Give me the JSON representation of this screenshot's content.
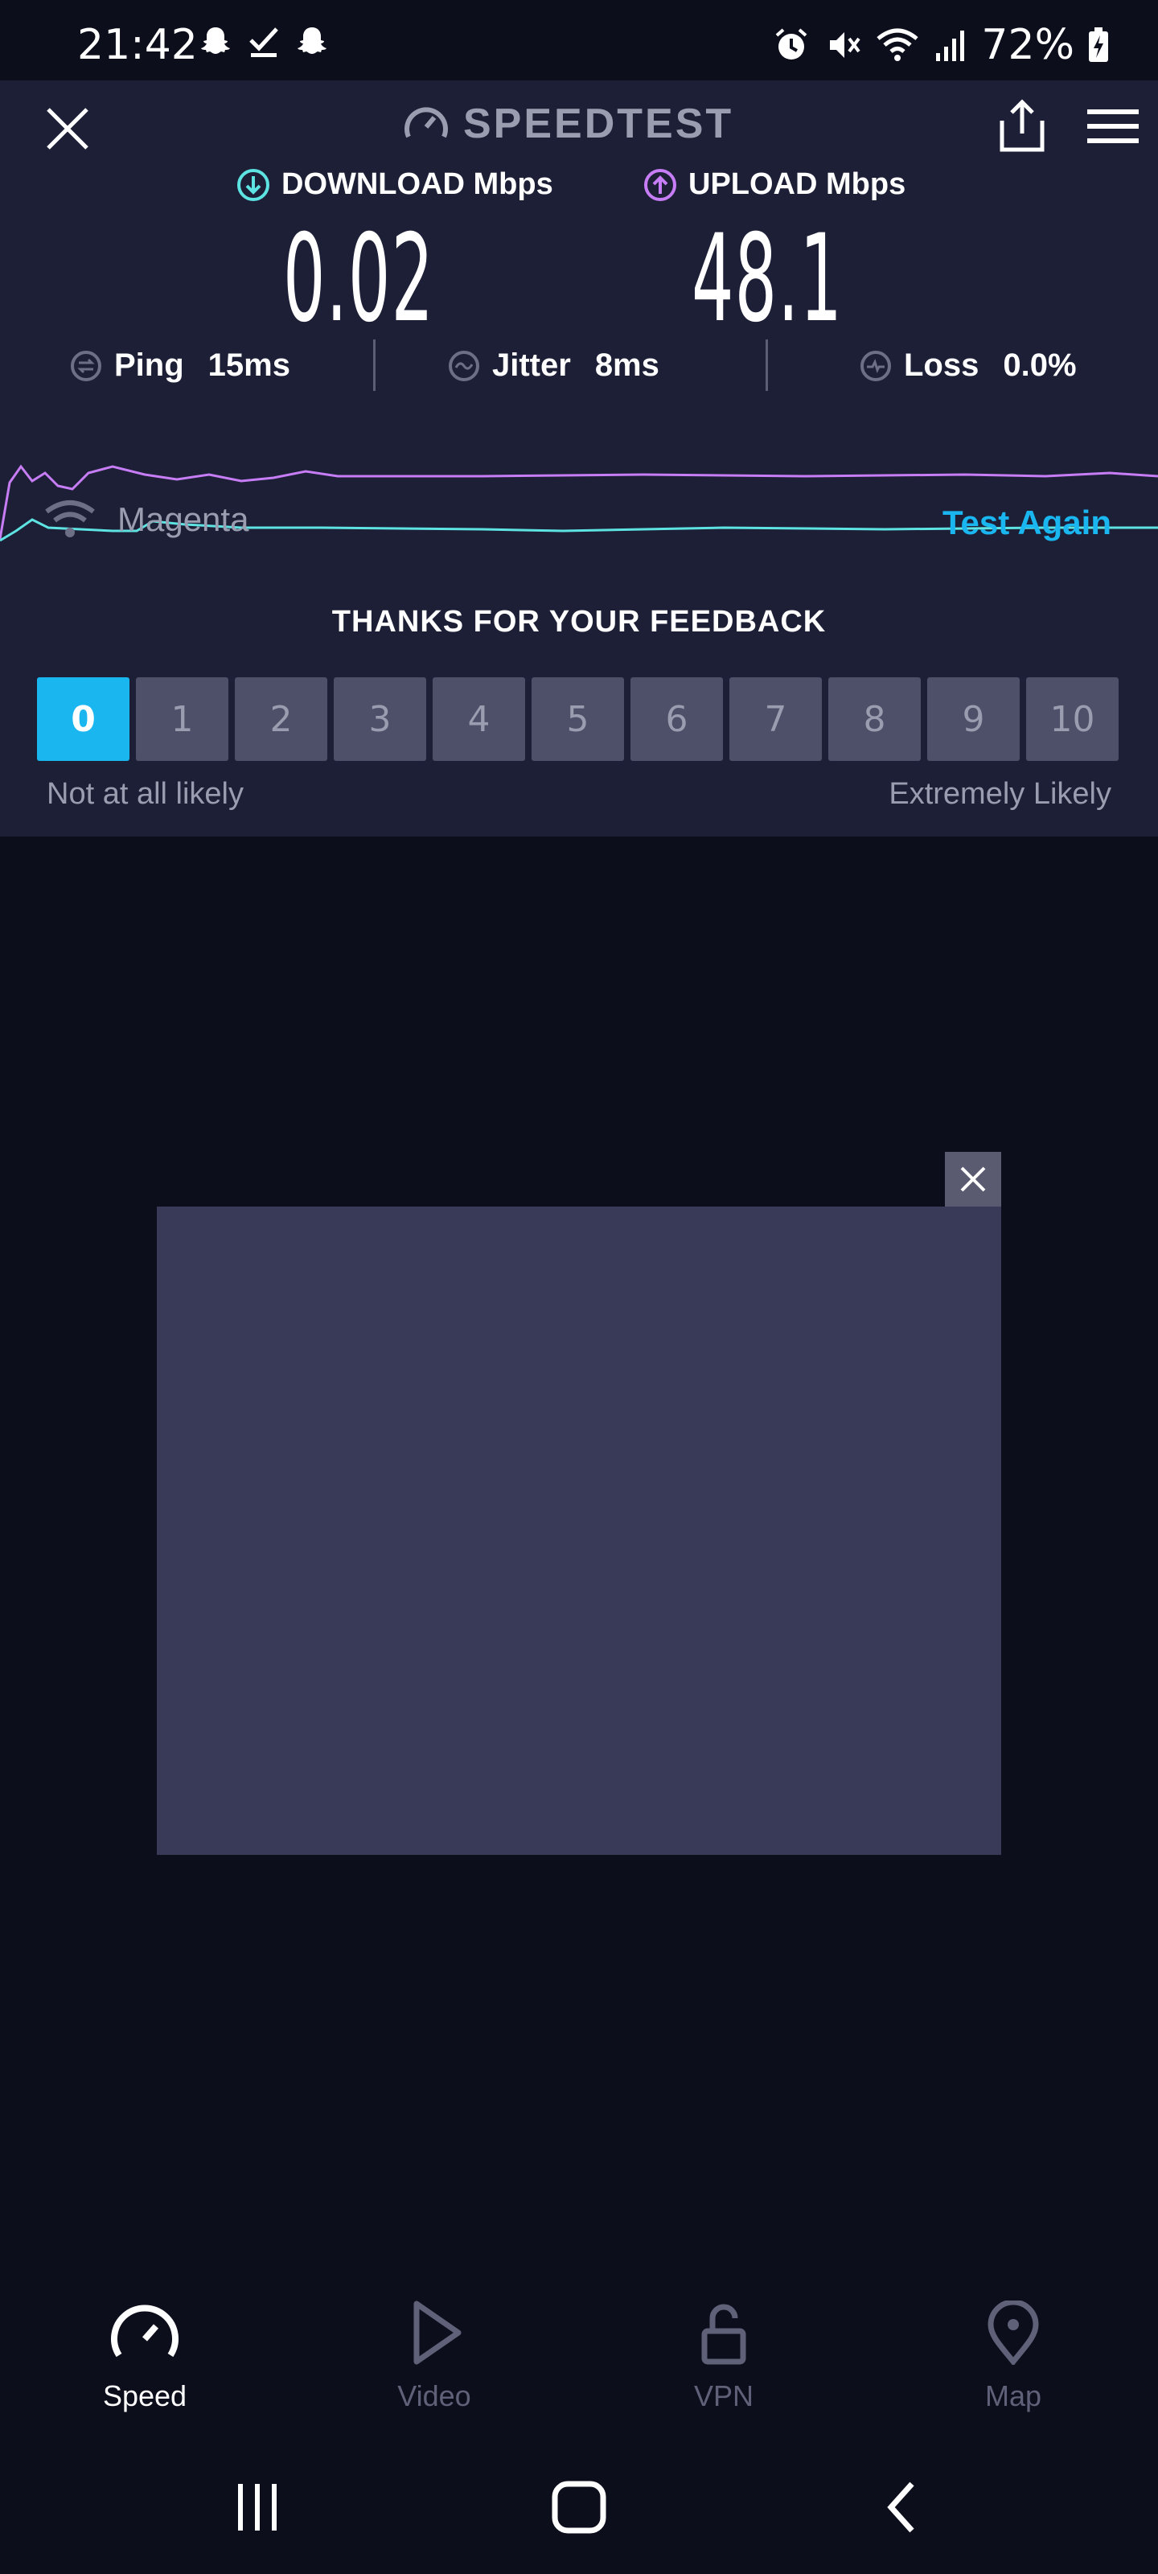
{
  "status_bar": {
    "time": "21:42",
    "battery": "72%",
    "left_icons": [
      "snapchat-icon",
      "check-icon",
      "snapchat-icon"
    ],
    "right_icons": [
      "alarm-icon",
      "mute-icon",
      "wifi-icon",
      "signal-icon",
      "battery-icon"
    ]
  },
  "header": {
    "app_title": "SPEEDTEST"
  },
  "results": {
    "download_label": "DOWNLOAD Mbps",
    "download_value": "0.02",
    "upload_label": "UPLOAD Mbps",
    "upload_value": "48.1",
    "ping_label": "Ping",
    "ping_value": "15ms",
    "jitter_label": "Jitter",
    "jitter_value": "8ms",
    "loss_label": "Loss",
    "loss_value": "0.0%"
  },
  "connection": {
    "network_name": "Magenta",
    "test_again_label": "Test Again"
  },
  "feedback": {
    "title": "THANKS FOR YOUR FEEDBACK",
    "scale": [
      "0",
      "1",
      "2",
      "3",
      "4",
      "5",
      "6",
      "7",
      "8",
      "9",
      "10"
    ],
    "selected": "0",
    "low_label": "Not at all likely",
    "high_label": "Extremely Likely"
  },
  "bottom_nav": {
    "items": [
      {
        "label": "Speed",
        "icon": "speedometer-icon",
        "active": true
      },
      {
        "label": "Video",
        "icon": "play-icon",
        "active": false
      },
      {
        "label": "VPN",
        "icon": "unlock-icon",
        "active": false
      },
      {
        "label": "Map",
        "icon": "map-pin-icon",
        "active": false
      }
    ]
  },
  "colors": {
    "background": "#0d0e1c",
    "panel": "#1d1f36",
    "accent": "#1ab6f0",
    "download": "#5ee3e3",
    "upload": "#c77df5",
    "muted": "#9a9cb0"
  }
}
